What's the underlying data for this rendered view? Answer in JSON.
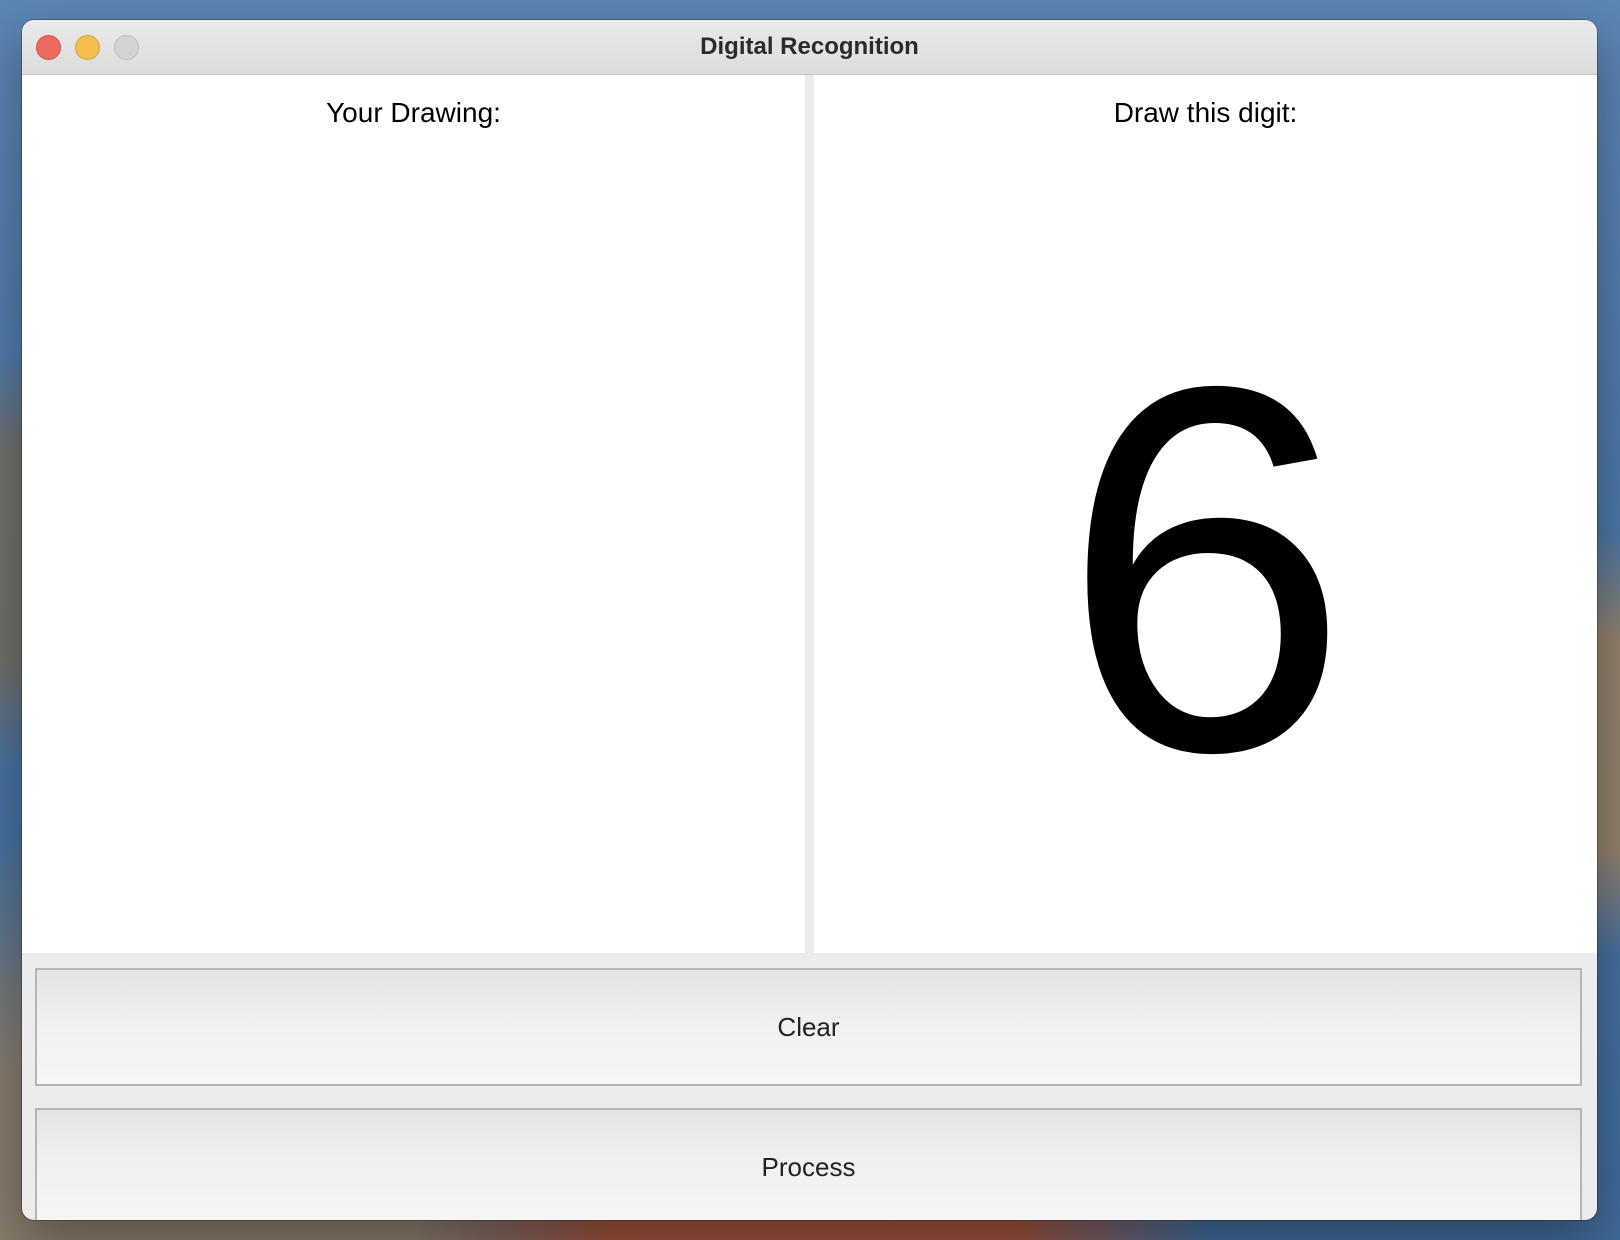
{
  "window": {
    "title": "Digital Recognition"
  },
  "left_panel": {
    "label": "Your Drawing:"
  },
  "right_panel": {
    "label": "Draw this digit:",
    "digit": "6"
  },
  "buttons": {
    "clear_label": "Clear",
    "process_label": "Process"
  },
  "colors": {
    "close": "#ed6a5e",
    "minimize": "#f5bf4f",
    "zoom_inactive": "#d4d4d4",
    "canvas_background": "#ffffff"
  }
}
